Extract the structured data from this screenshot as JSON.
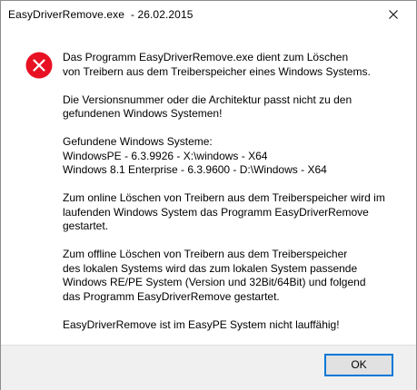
{
  "window": {
    "title": "EasyDriverRemove.exe  - 26.02.2015",
    "close_icon": "close-icon"
  },
  "dialog": {
    "icon": "error-icon",
    "paragraphs": [
      [
        "Das Programm EasyDriverRemove.exe dient zum Löschen",
        "von Treibern aus dem Treiberspeicher eines Windows Systems."
      ],
      [
        "Die Versionsnummer oder die Architektur passt nicht zu den",
        "gefundenen Windows Systemen!"
      ],
      [
        "Gefundene Windows Systeme:",
        "WindowsPE - 6.3.9926 - X:\\windows - X64",
        "Windows 8.1 Enterprise - 6.3.9600 - D:\\Windows - X64"
      ],
      [
        "Zum online Löschen von Treibern aus dem Treiberspeicher wird im",
        "laufenden Windows System das Programm EasyDriverRemove",
        "gestartet."
      ],
      [
        "Zum offline Löschen von Treibern aus dem Treiberspeicher",
        "des lokalen Systems wird das zum lokalen System passende",
        "Windows RE/PE System (Version und 32Bit/64Bit) und folgend",
        "das Programm EasyDriverRemove gestartet."
      ],
      [
        "EasyDriverRemove ist im EasyPE System nicht lauffähig!"
      ]
    ],
    "ok_label": "OK"
  },
  "colors": {
    "error_red": "#e81123",
    "button_border": "#0078d7",
    "footer_bg": "#f0f0f0"
  }
}
